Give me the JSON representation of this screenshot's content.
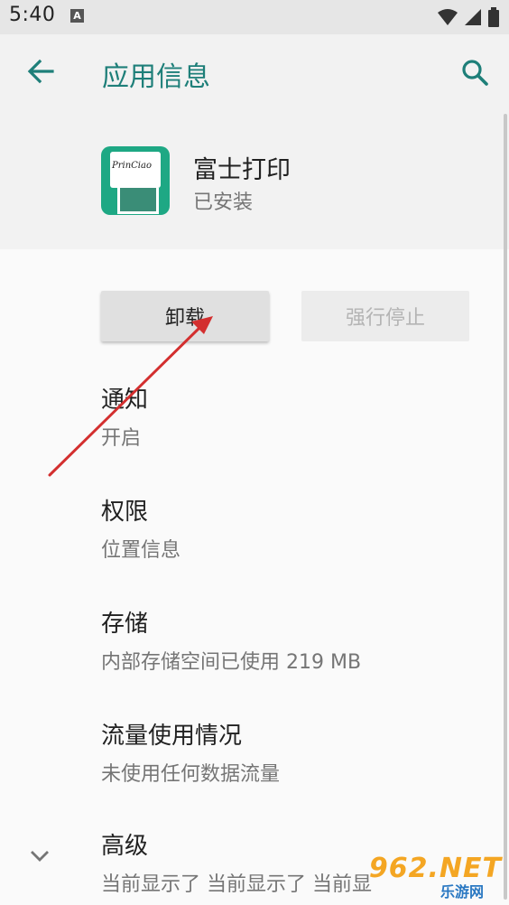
{
  "status_bar": {
    "time": "5:40",
    "notification_badge": "A",
    "icons": [
      "wifi-icon",
      "signal-icon",
      "battery-icon"
    ]
  },
  "app_bar": {
    "title": "应用信息",
    "back_icon": "arrow-back-icon",
    "search_icon": "search-icon"
  },
  "app": {
    "name": "富士打印",
    "status": "已安装",
    "icon_text": "PrinCiao"
  },
  "buttons": {
    "uninstall": "卸载",
    "force_stop": "强行停止"
  },
  "settings": [
    {
      "title": "通知",
      "subtitle": "开启"
    },
    {
      "title": "权限",
      "subtitle": "位置信息"
    },
    {
      "title": "存储",
      "subtitle": "内部存储空间已使用 219 MB"
    },
    {
      "title": "流量使用情况",
      "subtitle": "未使用任何数据流量"
    },
    {
      "title": "高级",
      "subtitle": "当前显示了 当前显示了 当前显"
    }
  ],
  "watermark": {
    "main": "962.NET",
    "sub": "乐游网"
  },
  "colors": {
    "accent": "#1e7f79",
    "annotation": "#d32f2f"
  }
}
